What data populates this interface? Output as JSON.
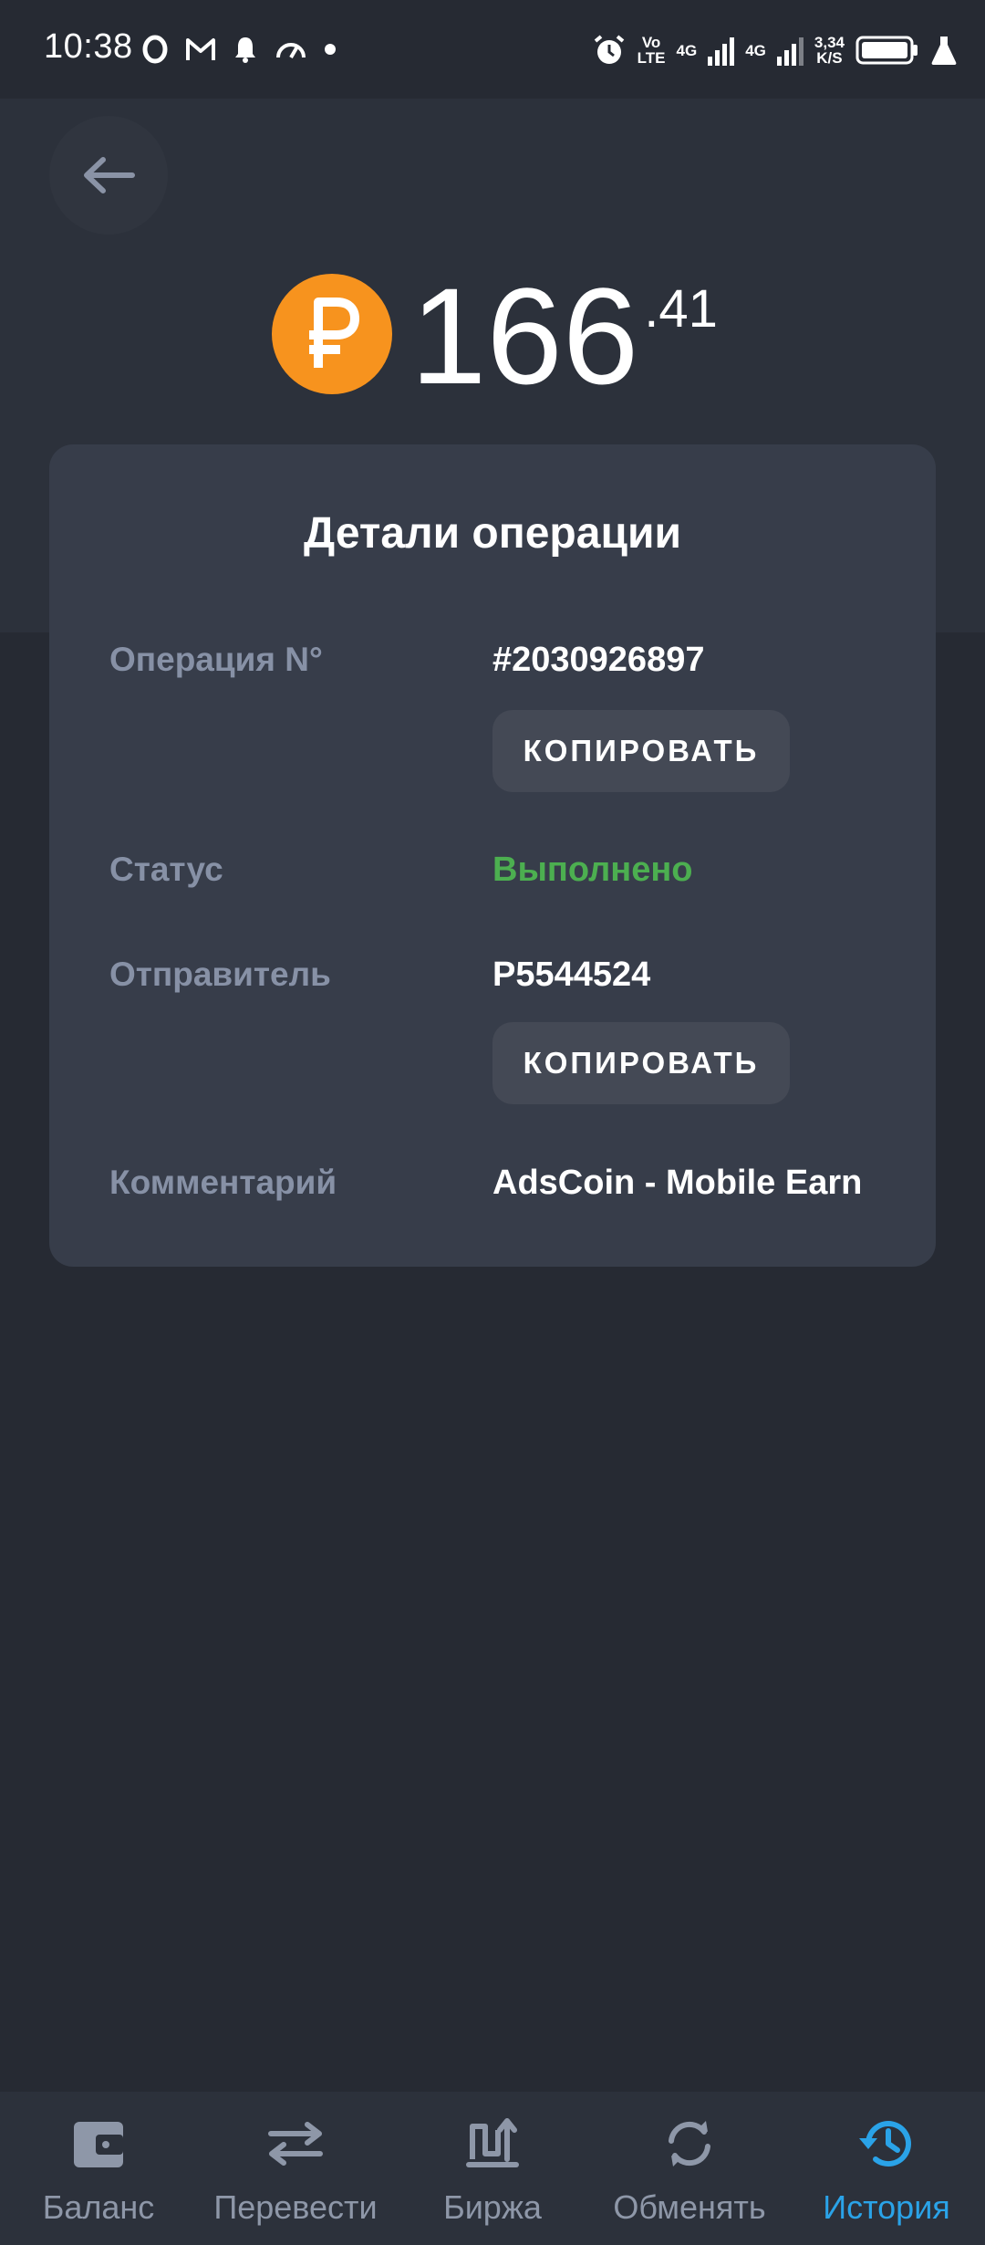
{
  "status_bar": {
    "time": "10:38",
    "network_vo": "Vo",
    "network_lte": "LTE",
    "sim1": "4G",
    "sim2": "4G",
    "speed_value": "3,34",
    "speed_unit": "K/S"
  },
  "balance": {
    "currency_icon": "ruble-coin-icon",
    "integer": "166",
    "fraction": ".41"
  },
  "details": {
    "title": "Детали операции",
    "rows": [
      {
        "label": "Операция N°",
        "value": "#2030926897",
        "copy_label": "КОПИРОВАТЬ"
      },
      {
        "label": "Статус",
        "value": "Выполнено",
        "status_color": "#4caf50"
      },
      {
        "label": "Отправитель",
        "value": "P5544524",
        "copy_label": "КОПИРОВАТЬ"
      },
      {
        "label": "Комментарий",
        "value": "AdsCoin - Mobile Earn"
      }
    ]
  },
  "nav": {
    "items": [
      {
        "label": "Баланс",
        "icon": "wallet-icon"
      },
      {
        "label": "Перевести",
        "icon": "transfer-arrows-icon"
      },
      {
        "label": "Биржа",
        "icon": "exchange-chart-icon"
      },
      {
        "label": "Обменять",
        "icon": "refresh-icon"
      },
      {
        "label": "История",
        "icon": "history-clock-icon",
        "active": true
      }
    ],
    "active_color": "#2aa3e8"
  }
}
